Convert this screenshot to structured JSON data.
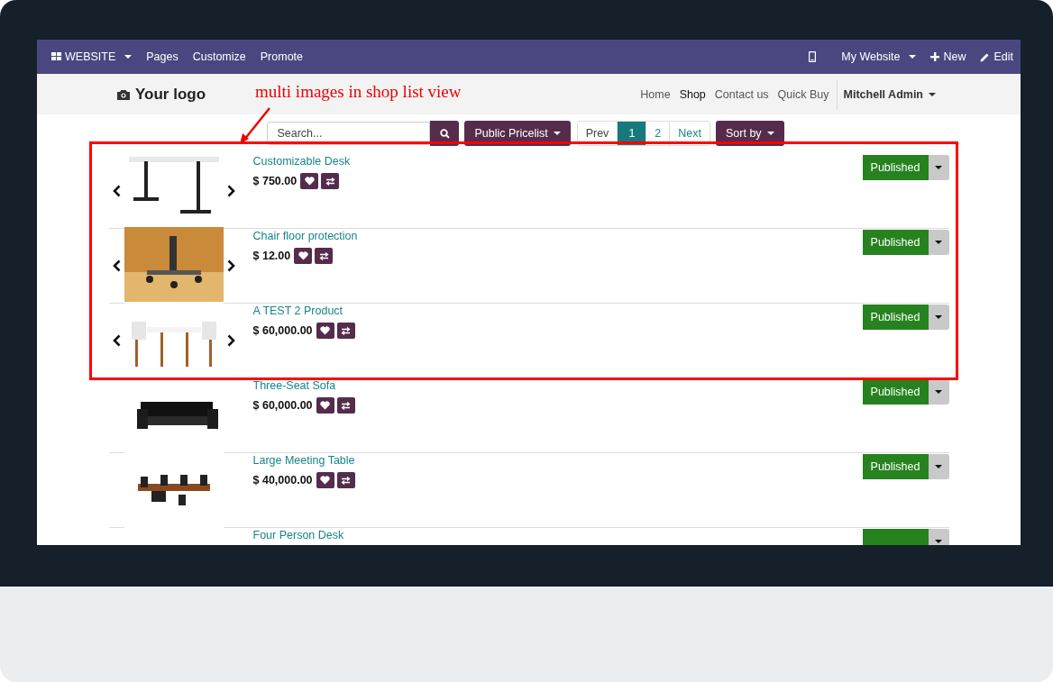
{
  "top_bar": {
    "app_menu": "WEBSITE",
    "items": [
      "Pages",
      "Customize",
      "Promote"
    ],
    "right_items": [
      {
        "label": "My Website",
        "kind": "dropdown"
      },
      {
        "label": "New",
        "kind": "plus"
      },
      {
        "label": "Edit",
        "kind": "pencil"
      }
    ]
  },
  "header": {
    "logo": "Your logo",
    "nav": [
      {
        "label": "Home",
        "selected": false
      },
      {
        "label": "Shop",
        "selected": true
      },
      {
        "label": "Contact us",
        "selected": false
      },
      {
        "label": "Quick Buy",
        "selected": false
      }
    ],
    "user": "Mitchell Admin"
  },
  "annotation": {
    "text": "multi images in shop list view"
  },
  "toolbar": {
    "search_placeholder": "Search...",
    "pricelist": "Public Pricelist",
    "pager": [
      {
        "label": "Prev",
        "selected": false
      },
      {
        "label": "1",
        "selected": true
      },
      {
        "label": "2",
        "selected": false
      },
      {
        "label": "Next",
        "selected": false
      }
    ],
    "sort": "Sort by"
  },
  "products": [
    {
      "kind": "full",
      "name": "Customizable Desk",
      "price": "$ 750.00",
      "carousel": true,
      "published": true,
      "status": "Published"
    },
    {
      "kind": "full",
      "name": "Chair floor protection",
      "price": "$ 12.00",
      "carousel": true,
      "published": true,
      "status": "Published"
    },
    {
      "kind": "full",
      "name": "A TEST 2 Product",
      "price": "$ 60,000.00",
      "carousel": true,
      "published": true,
      "status": "Published"
    },
    {
      "kind": "full",
      "name": "Three-Seat Sofa",
      "price": "$ 60,000.00",
      "carousel": false,
      "published": true,
      "status": "Published"
    },
    {
      "kind": "full",
      "name": "Large Meeting Table",
      "price": "$ 40,000.00",
      "carousel": false,
      "published": true,
      "status": "Published"
    },
    {
      "kind": "cut",
      "name": "Four Person Desk",
      "carousel": false,
      "published": true
    }
  ]
}
